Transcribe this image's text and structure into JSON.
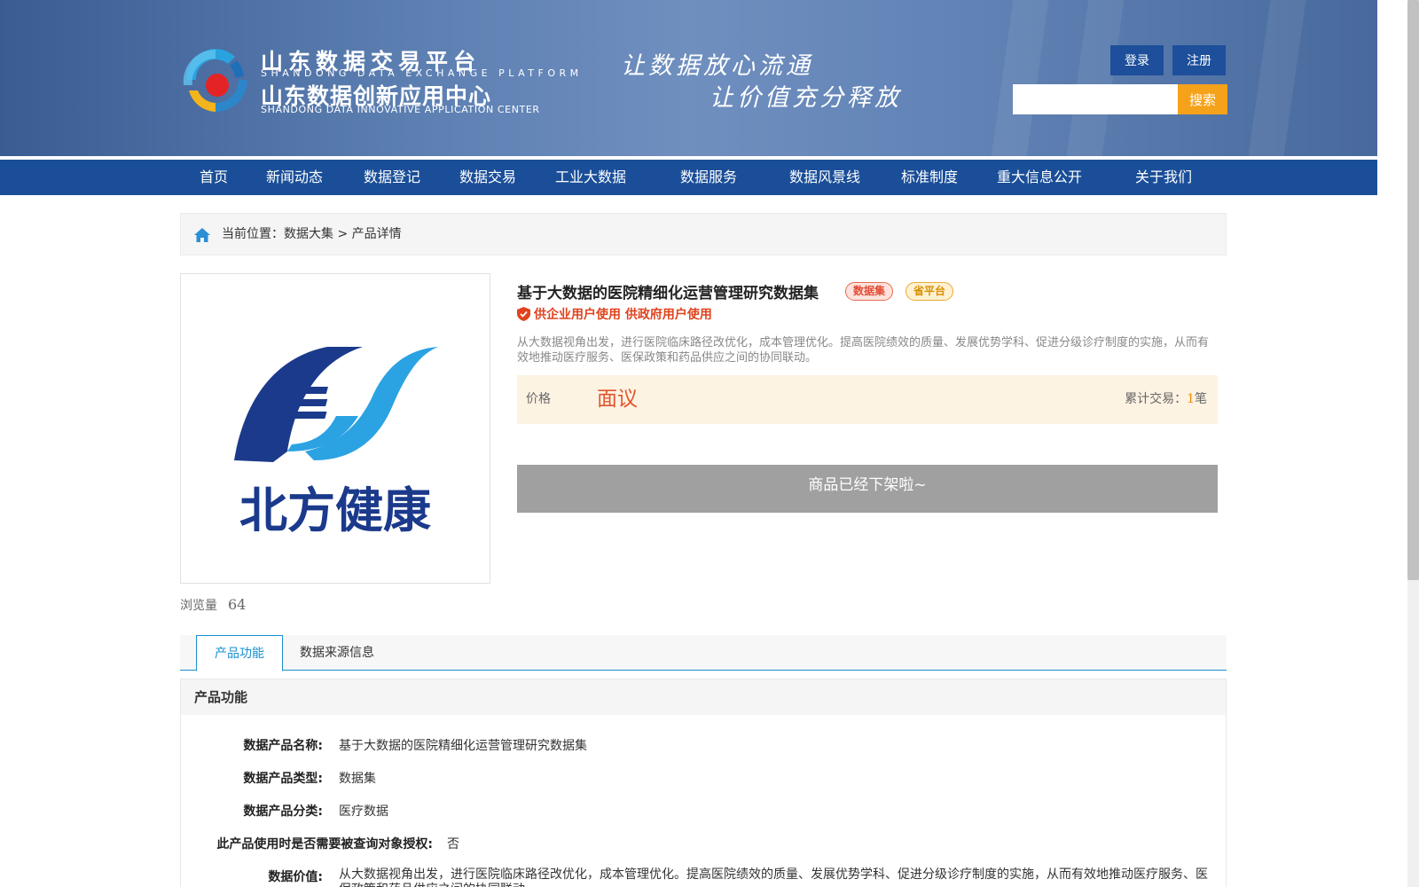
{
  "header": {
    "brand_cn_line1": "山东数据交易平台",
    "brand_en_line1": "SHANDONG DATA EXCHANGE PLATFORM",
    "brand_cn_line2": "山东数据创新应用中心",
    "brand_en_line2": "SHANDONG DATA INNOVATIVE APPLICATION CENTER",
    "slogan_line1": "让数据放心流通",
    "slogan_line2": "让价值充分释放",
    "login_label": "登录",
    "register_label": "注册",
    "search_placeholder": "",
    "search_label": "搜索"
  },
  "nav": {
    "items": [
      "首页",
      "新闻动态",
      "数据登记",
      "数据交易",
      "工业大数据",
      "数据服务",
      "数据风景线",
      "标准制度",
      "重大信息公开",
      "关于我们"
    ]
  },
  "breadcrumb": {
    "text": "当前位置：数据大集 > 产品详情"
  },
  "product": {
    "image_logo_text": "北方健康",
    "views_label": "浏览量",
    "views_count": "64",
    "title": "基于大数据的医院精细化运营管理研究数据集",
    "badge_type": "数据集",
    "badge_platform": "省平台",
    "usage": "供企业用户使用 供政府用户使用",
    "description": "从大数据视角出发，进行医院临床路径改优化，成本管理优化。提高医院绩效的质量、发展优势学科、促进分级诊疗制度的实施，从而有效地推动医疗服务、医保政策和药品供应之间的协同联动。",
    "price_label": "价格",
    "price_value": "面议",
    "trade_label": "累计交易：",
    "trade_count": "1",
    "trade_unit": "笔",
    "offline_text": "商品已经下架啦~"
  },
  "tabs": {
    "function": "产品功能",
    "source": "数据来源信息"
  },
  "section": {
    "title": "产品功能",
    "rows": [
      {
        "key": "数据产品名称:",
        "value": "基于大数据的医院精细化运营管理研究数据集"
      },
      {
        "key": "数据产品类型:",
        "value": "数据集"
      },
      {
        "key": "数据产品分类:",
        "value": "医疗数据"
      },
      {
        "key": "此产品使用时是否需要被查询对象授权:",
        "value": "否"
      },
      {
        "key": "数据价值:",
        "value": "从大数据视角出发，进行医院临床路径改优化，成本管理优化。提高医院绩效的质量、发展优势学科、促进分级诊疗制度的实施，从而有效地推动医疗服务、医保政策和药品供应之间的协同联动。"
      }
    ]
  },
  "colors": {
    "nav_bg": "#1a4e98",
    "accent_orange": "#f5a21b",
    "price_red": "#e2562d",
    "tab_blue": "#1890d0"
  }
}
